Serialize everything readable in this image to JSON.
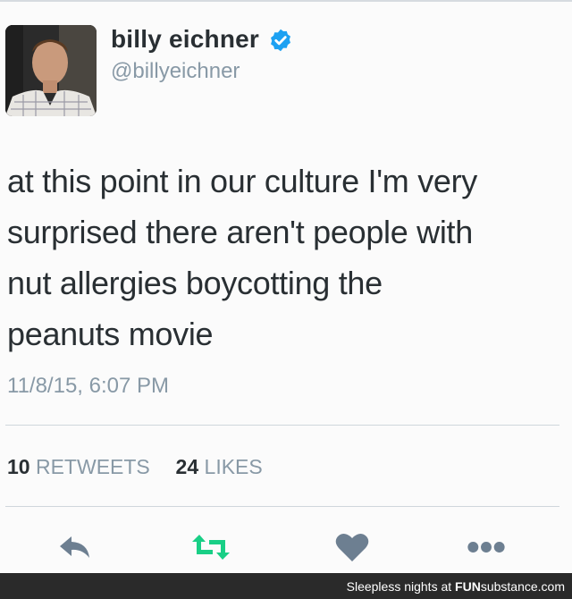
{
  "user": {
    "display_name": "billy eichner",
    "handle": "@billyeichner",
    "verified": true,
    "avatar_icon": "profile-photo"
  },
  "tweet": {
    "lines": [
      "at this point in our culture I'm very",
      "surprised there aren't people with",
      "nut allergies boycotting the",
      "peanuts movie"
    ],
    "timestamp": "11/8/15, 6:07 PM"
  },
  "stats": {
    "retweets_count": "10",
    "retweets_label": "RETWEETS",
    "likes_count": "24",
    "likes_label": "LIKES"
  },
  "actions": {
    "reply_icon": "reply-icon",
    "retweet_icon": "retweet-icon",
    "like_icon": "heart-icon",
    "more_icon": "more-icon"
  },
  "watermark": {
    "prefix": "Sleepless nights at",
    "brand_bold": "FUN",
    "brand_rest": "substance.com"
  },
  "colors": {
    "text": "#292f33",
    "muted": "#8899a6",
    "verified": "#1da1f2",
    "retweet": "#19cf86",
    "icon": "#6d7f91"
  }
}
